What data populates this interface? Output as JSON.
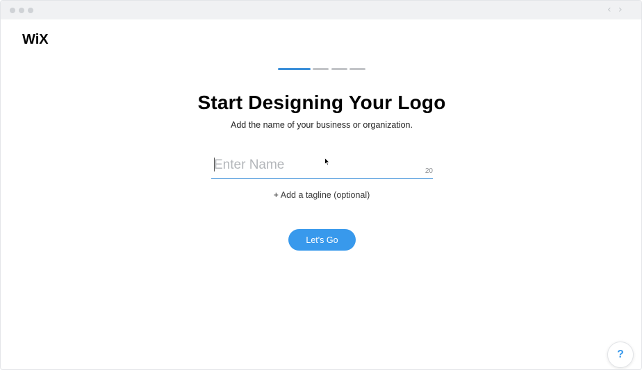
{
  "browser": {
    "back_icon": "‹",
    "forward_icon": "›"
  },
  "brand": {
    "logo_text": "WiX"
  },
  "progress": {
    "current_step": 1,
    "total_steps": 4
  },
  "main": {
    "title": "Start Designing Your Logo",
    "subtitle": "Add the name of your business or organization.",
    "name_field": {
      "placeholder": "Enter Name",
      "value": "",
      "char_limit": "20"
    },
    "tagline_link": "+ Add a tagline (optional)",
    "submit_label": "Let's Go"
  },
  "help": {
    "label": "?"
  },
  "colors": {
    "accent": "#3899ec",
    "progress_active": "#3b8fd9",
    "progress_inactive": "#c2c4c7"
  }
}
